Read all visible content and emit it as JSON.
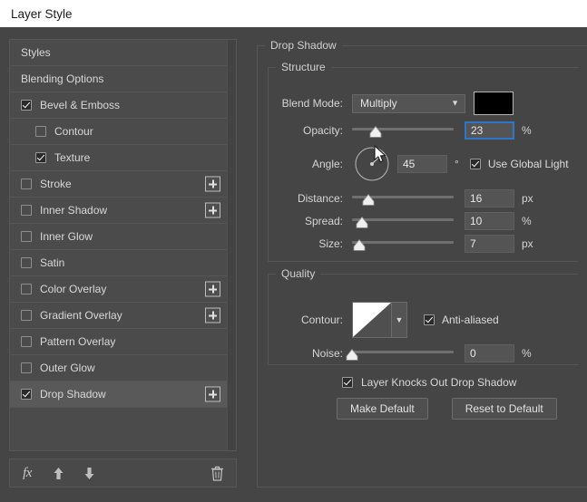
{
  "window": {
    "title": "Layer Style"
  },
  "sidebar": {
    "items": [
      {
        "label": "Styles",
        "checkbox": "none",
        "indent": false,
        "plus": false,
        "selected": false
      },
      {
        "label": "Blending Options",
        "checkbox": "none",
        "indent": false,
        "plus": false,
        "selected": false
      },
      {
        "label": "Bevel & Emboss",
        "checkbox": "checked",
        "indent": false,
        "plus": false,
        "selected": false
      },
      {
        "label": "Contour",
        "checkbox": "unchecked",
        "indent": true,
        "plus": false,
        "selected": false
      },
      {
        "label": "Texture",
        "checkbox": "checked",
        "indent": true,
        "plus": false,
        "selected": false
      },
      {
        "label": "Stroke",
        "checkbox": "unchecked",
        "indent": false,
        "plus": true,
        "selected": false
      },
      {
        "label": "Inner Shadow",
        "checkbox": "unchecked",
        "indent": false,
        "plus": true,
        "selected": false
      },
      {
        "label": "Inner Glow",
        "checkbox": "unchecked",
        "indent": false,
        "plus": false,
        "selected": false
      },
      {
        "label": "Satin",
        "checkbox": "unchecked",
        "indent": false,
        "plus": false,
        "selected": false
      },
      {
        "label": "Color Overlay",
        "checkbox": "unchecked",
        "indent": false,
        "plus": true,
        "selected": false
      },
      {
        "label": "Gradient Overlay",
        "checkbox": "unchecked",
        "indent": false,
        "plus": true,
        "selected": false
      },
      {
        "label": "Pattern Overlay",
        "checkbox": "unchecked",
        "indent": false,
        "plus": false,
        "selected": false
      },
      {
        "label": "Outer Glow",
        "checkbox": "unchecked",
        "indent": false,
        "plus": false,
        "selected": false
      },
      {
        "label": "Drop Shadow",
        "checkbox": "checked",
        "indent": false,
        "plus": true,
        "selected": true
      }
    ],
    "toolbar": {
      "fx_label": "fx",
      "fx_icon": "fx-icon",
      "move_up_icon": "arrow-up-icon",
      "move_down_icon": "arrow-down-icon",
      "delete_icon": "trash-icon"
    }
  },
  "panel": {
    "effect_title": "Drop Shadow",
    "structure": {
      "legend": "Structure",
      "blend_mode": {
        "label": "Blend Mode:",
        "value": "Multiply",
        "chevron_icon": "chevron-down-icon"
      },
      "shadow_color": {
        "name": "shadow-color-swatch",
        "hex": "#000000"
      },
      "opacity": {
        "label": "Opacity:",
        "value": "23",
        "unit": "%",
        "slider_percent": 23,
        "focused": true
      },
      "angle": {
        "label": "Angle:",
        "value": "45",
        "unit": "°",
        "dial_degrees": 45
      },
      "use_global_light": {
        "label": "Use Global Light",
        "checked": true
      },
      "distance": {
        "label": "Distance:",
        "value": "16",
        "unit": "px",
        "slider_percent": 16
      },
      "spread": {
        "label": "Spread:",
        "value": "10",
        "unit": "%",
        "slider_percent": 10
      },
      "size": {
        "label": "Size:",
        "value": "7",
        "unit": "px",
        "slider_percent": 7
      }
    },
    "quality": {
      "legend": "Quality",
      "contour": {
        "label": "Contour:",
        "chevron_icon": "chevron-down-icon"
      },
      "anti_aliased": {
        "label": "Anti-aliased",
        "checked": true
      },
      "noise": {
        "label": "Noise:",
        "value": "0",
        "unit": "%",
        "slider_percent": 0
      }
    },
    "knockout": {
      "label": "Layer Knocks Out Drop Shadow",
      "checked": true
    },
    "buttons": {
      "make_default": "Make Default",
      "reset_to_default": "Reset to Default"
    }
  },
  "colors": {
    "panel_bg": "#454545",
    "list_bg": "#4b4b4b",
    "selected_row": "#595959",
    "focus_blue": "#2f76c7",
    "titlebar_bg": "#ffffff"
  }
}
